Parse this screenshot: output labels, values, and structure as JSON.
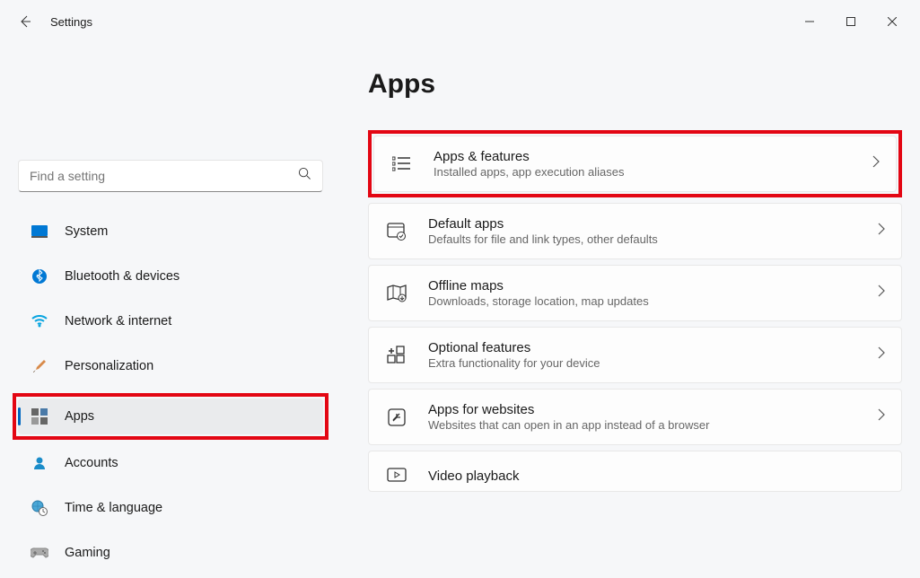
{
  "titlebar": {
    "title": "Settings"
  },
  "search": {
    "placeholder": "Find a setting"
  },
  "sidebar": {
    "items": [
      {
        "label": "System"
      },
      {
        "label": "Bluetooth & devices"
      },
      {
        "label": "Network & internet"
      },
      {
        "label": "Personalization"
      },
      {
        "label": "Apps"
      },
      {
        "label": "Accounts"
      },
      {
        "label": "Time & language"
      },
      {
        "label": "Gaming"
      }
    ]
  },
  "main": {
    "title": "Apps",
    "cards": [
      {
        "title": "Apps & features",
        "sub": "Installed apps, app execution aliases"
      },
      {
        "title": "Default apps",
        "sub": "Defaults for file and link types, other defaults"
      },
      {
        "title": "Offline maps",
        "sub": "Downloads, storage location, map updates"
      },
      {
        "title": "Optional features",
        "sub": "Extra functionality for your device"
      },
      {
        "title": "Apps for websites",
        "sub": "Websites that can open in an app instead of a browser"
      },
      {
        "title": "Video playback",
        "sub": ""
      }
    ]
  }
}
